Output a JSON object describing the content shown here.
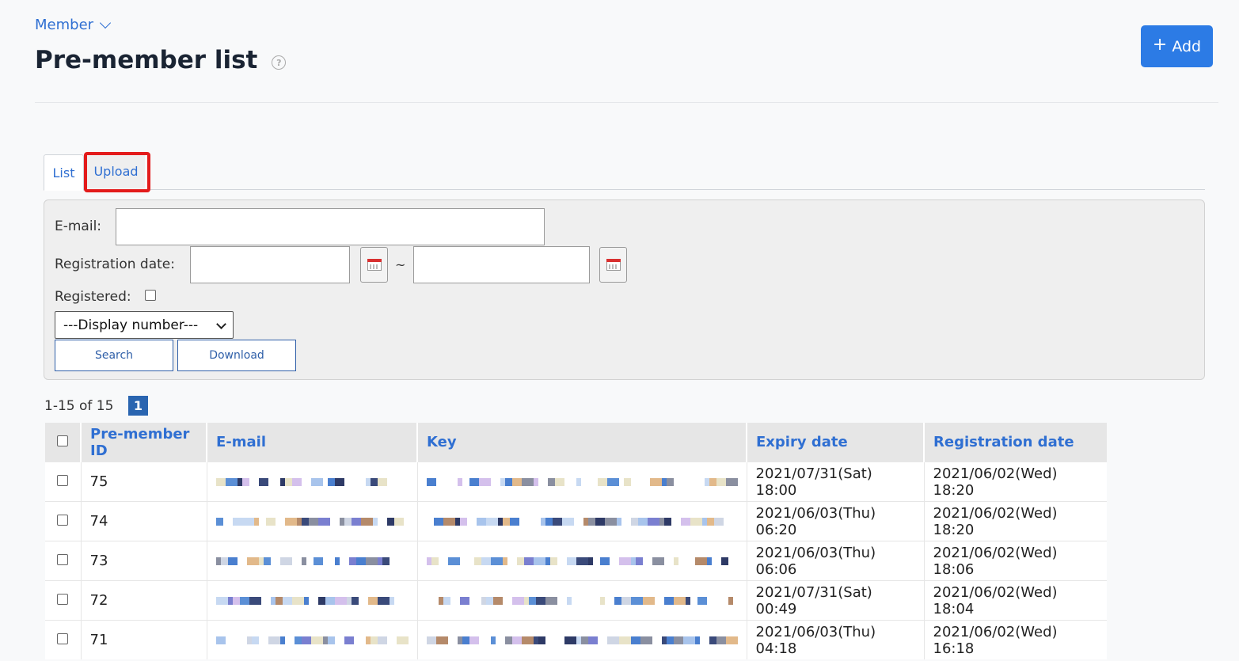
{
  "breadcrumb": {
    "label": "Member"
  },
  "page": {
    "title": "Pre-member list"
  },
  "header": {
    "add_label": "Add"
  },
  "tabs": [
    {
      "label": "List",
      "active": true
    },
    {
      "label": "Upload",
      "active": false,
      "highlighted": true
    }
  ],
  "filter": {
    "email_label": "E-mail:",
    "email_value": "",
    "regdate_label": "Registration date:",
    "regdate_from": "",
    "regdate_to": "",
    "range_sep": "~",
    "registered_label": "Registered:",
    "registered_checked": false,
    "display_number": "---Display number---",
    "search_label": "Search",
    "download_label": "Download"
  },
  "pagination": {
    "summary": "1-15 of 15",
    "current_page": "1"
  },
  "table": {
    "columns": [
      "Pre-member ID",
      "E-mail",
      "Key",
      "Expiry date",
      "Registration date"
    ],
    "rows": [
      {
        "id": "75",
        "email": "[redacted]",
        "key": "[redacted]",
        "expiry": "2021/07/31(Sat) 18:00",
        "registered": "2021/06/02(Wed) 18:20"
      },
      {
        "id": "74",
        "email": "[redacted]",
        "key": "[redacted]",
        "expiry": "2021/06/03(Thu) 06:20",
        "registered": "2021/06/02(Wed) 18:20"
      },
      {
        "id": "73",
        "email": "[redacted]",
        "key": "[redacted]",
        "expiry": "2021/06/03(Thu) 06:06",
        "registered": "2021/06/02(Wed) 18:06"
      },
      {
        "id": "72",
        "email": "[redacted]",
        "key": "[redacted]",
        "expiry": "2021/07/31(Sat) 00:49",
        "registered": "2021/06/02(Wed) 18:04"
      },
      {
        "id": "71",
        "email": "[redacted]",
        "key": "[redacted]",
        "expiry": "2021/06/03(Thu) 04:18",
        "registered": "2021/06/02(Wed) 16:18"
      }
    ]
  },
  "colors": {
    "accent": "#2c7be5",
    "link": "#2f6fd2",
    "highlight": "#e31b1b"
  }
}
